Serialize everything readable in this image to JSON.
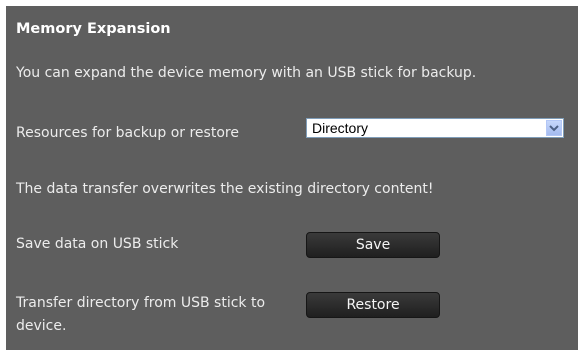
{
  "panel": {
    "title": "Memory Expansion",
    "intro": "You can expand the device memory with an USB stick for backup.",
    "resources": {
      "label": "Resources for backup or restore",
      "selected": "Directory"
    },
    "warning": "The data transfer overwrites the existing directory content!",
    "save": {
      "label": "Save data on USB stick",
      "button": "Save"
    },
    "restore": {
      "label": "Transfer directory from USB stick to device.",
      "button": "Restore"
    }
  },
  "colors": {
    "panel_background": "#5e5e5e",
    "button_background": "#2a2a2a",
    "text": "#ececec"
  },
  "icons": {
    "dropdown": "chevron-down-icon"
  }
}
